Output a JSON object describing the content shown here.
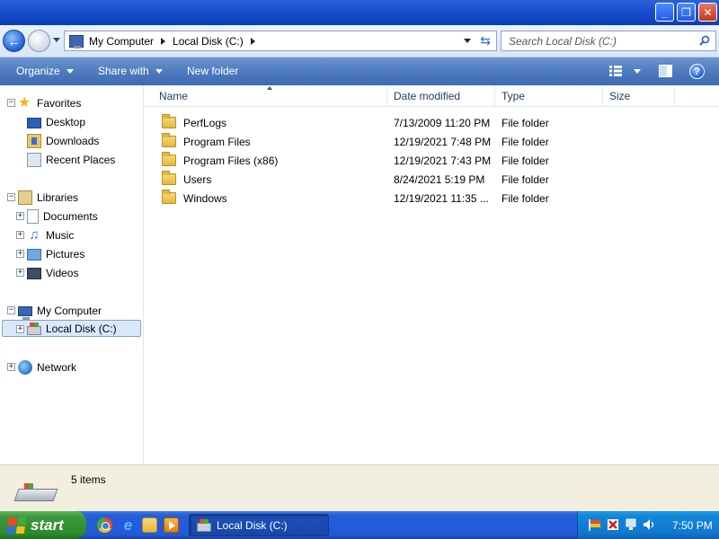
{
  "window": {
    "buttons": {
      "minimize": "_",
      "maximize": "❐",
      "close": "✕"
    }
  },
  "address": {
    "crumbs": [
      "My Computer",
      "Local Disk (C:)"
    ],
    "search_placeholder": "Search Local Disk (C:)"
  },
  "toolbar": {
    "organize": "Organize",
    "share_with": "Share with",
    "new_folder": "New folder",
    "help": "?"
  },
  "nav": {
    "favorites": "Favorites",
    "desktop": "Desktop",
    "downloads": "Downloads",
    "recent_places": "Recent Places",
    "libraries": "Libraries",
    "documents": "Documents",
    "music": "Music",
    "pictures": "Pictures",
    "videos": "Videos",
    "my_computer": "My Computer",
    "local_disk": "Local Disk (C:)",
    "network": "Network"
  },
  "columns": {
    "name": "Name",
    "date_modified": "Date modified",
    "type": "Type",
    "size": "Size"
  },
  "files": [
    {
      "name": "PerfLogs",
      "date": "7/13/2009 11:20 PM",
      "type": "File folder"
    },
    {
      "name": "Program Files",
      "date": "12/19/2021 7:48 PM",
      "type": "File folder"
    },
    {
      "name": "Program Files (x86)",
      "date": "12/19/2021 7:43 PM",
      "type": "File folder"
    },
    {
      "name": "Users",
      "date": "8/24/2021 5:19 PM",
      "type": "File folder"
    },
    {
      "name": "Windows",
      "date": "12/19/2021 11:35 ...",
      "type": "File folder"
    }
  ],
  "details": {
    "count": "5 items"
  },
  "taskbar": {
    "start_label": "start",
    "task_label": "Local Disk (C:)",
    "clock": "7:50 PM"
  }
}
